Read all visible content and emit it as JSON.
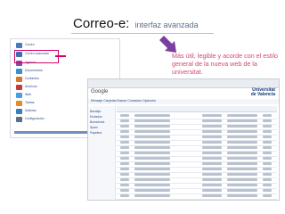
{
  "slide": {
    "title": "Correo-e:",
    "subtitle": "interfaz avanzada",
    "note": "Más útil, legible y acorde con el estilo general de la nueva web de la universitat."
  },
  "colors": {
    "accent": "#d4006a",
    "note_text": "#d24a72",
    "link_blue": "#2b4a8a"
  },
  "left_portal": {
    "items": [
      {
        "icon": "mail-icon",
        "label": "Correo"
      },
      {
        "icon": "mail-icon",
        "label": "Correo avanzado"
      },
      {
        "icon": "calendar-icon",
        "label": "Agenda"
      },
      {
        "icon": "document-icon",
        "label": "Documentos"
      },
      {
        "icon": "contacts-icon",
        "label": "Contactos"
      },
      {
        "icon": "folder-icon",
        "label": "Archivos"
      },
      {
        "icon": "globe-icon",
        "label": "Web"
      },
      {
        "icon": "tasks-icon",
        "label": "Tareas"
      },
      {
        "icon": "news-icon",
        "label": "Noticias"
      },
      {
        "icon": "settings-icon",
        "label": "Configuración"
      }
    ]
  },
  "webmail": {
    "logo": "Google",
    "brand_line1": "Universitat",
    "brand_line2": "de Valencia",
    "menu": "Mensaje   Carpetas   Buscar   Contactos   Opciones",
    "side_items": [
      "Bandeja",
      "Enviados",
      "Borradores",
      "Spam",
      "Papelera"
    ],
    "row_count": 16
  }
}
